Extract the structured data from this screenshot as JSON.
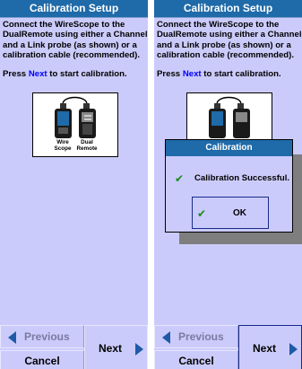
{
  "screens": [
    {
      "title": "Calibration Setup",
      "instructions": "Connect the WireScope to the DualRemote using either a Channel and a Link probe (as shown) or a calibration cable (recommended).",
      "press_prefix": "Press ",
      "press_link": "Next",
      "press_suffix": " to start calibration.",
      "diagram": {
        "device_left": "Wire\nScope",
        "device_right": "Dual\nRemote"
      },
      "buttons": {
        "previous": "Previous",
        "cancel": "Cancel",
        "next": "Next"
      }
    },
    {
      "title": "Calibration Setup",
      "instructions": "Connect the WireScope to the DualRemote using either a Channel and a Link probe (as shown) or a calibration cable (recommended).",
      "press_prefix": "Press ",
      "press_link": "Next",
      "press_suffix": " to start calibration.",
      "buttons": {
        "previous": "Previous",
        "cancel": "Cancel",
        "next": "Next"
      },
      "dialog": {
        "title": "Calibration",
        "message": "Calibration Successful.",
        "ok_label": "OK",
        "check_icon": "✔"
      }
    }
  ],
  "colors": {
    "accent": "#1f6aa8",
    "panel_background": "#cbcbfb",
    "link_blue": "#0000ff",
    "success_green": "#1a8a1a",
    "disabled_text": "#7a7aa0"
  },
  "icons": {
    "previous": "triangle-left-icon",
    "next": "triangle-right-icon",
    "success": "check-icon"
  }
}
